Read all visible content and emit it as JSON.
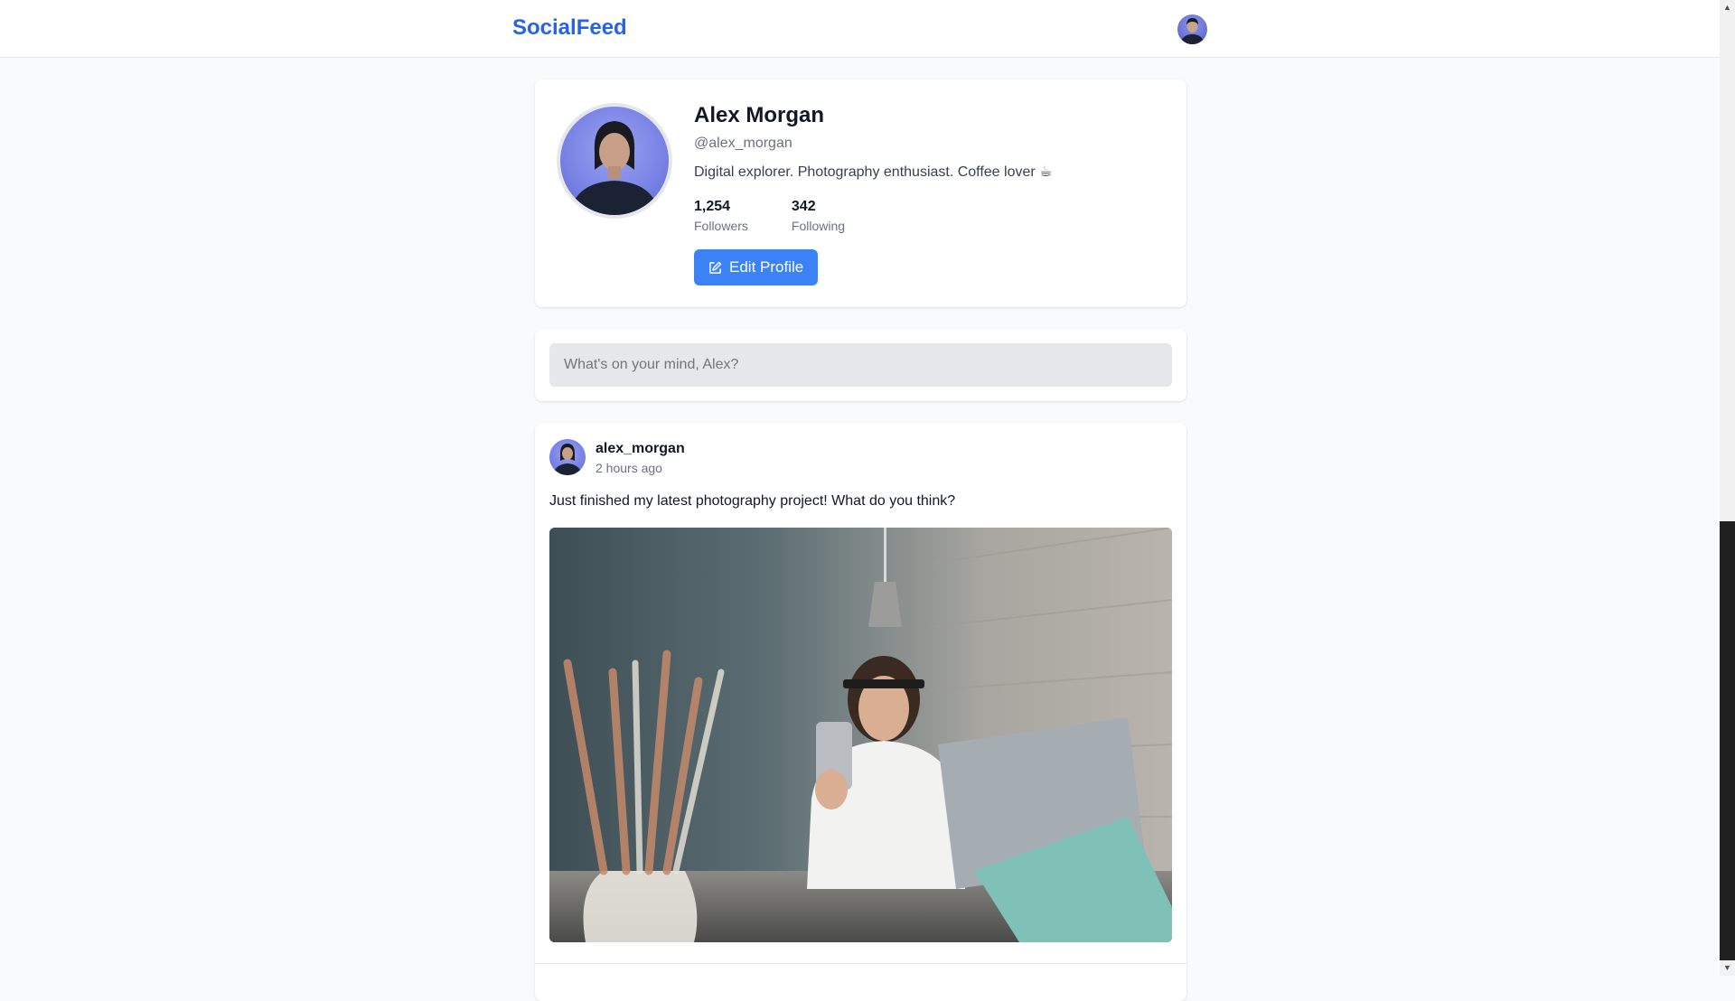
{
  "header": {
    "brand": "SocialFeed"
  },
  "profile": {
    "name": "Alex Morgan",
    "handle": "@alex_morgan",
    "bio": "Digital explorer. Photography enthusiast. Coffee lover ☕",
    "stats": [
      {
        "value": "1,254",
        "label": "Followers"
      },
      {
        "value": "342",
        "label": "Following"
      }
    ],
    "edit_label": "Edit Profile"
  },
  "composer": {
    "placeholder": "What's on your mind, Alex?"
  },
  "post": {
    "author": "alex_morgan",
    "time": "2 hours ago",
    "text": "Just finished my latest photography project! What do you think?"
  },
  "colors": {
    "brand": "#2563eb",
    "button": "#3b82f6",
    "background": "#f9fafb"
  }
}
